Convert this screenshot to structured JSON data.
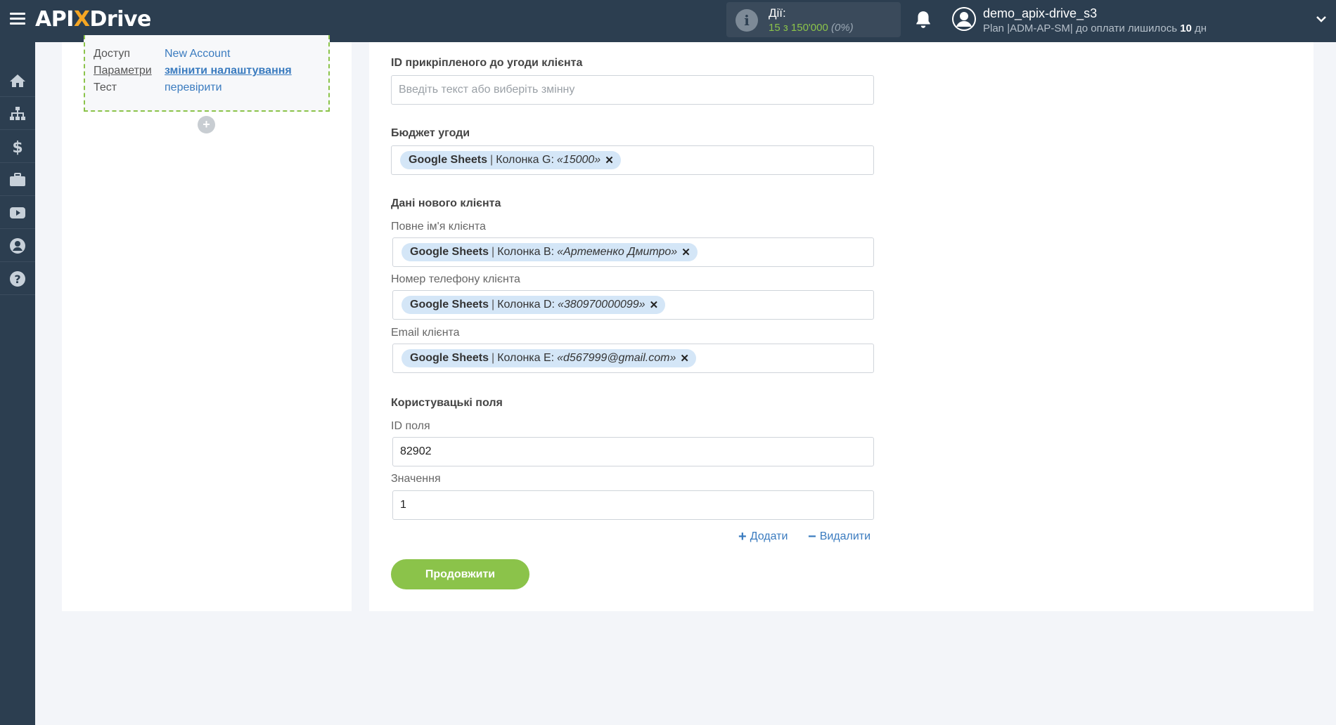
{
  "header": {
    "logo_api": "API",
    "logo_x": "X",
    "logo_drive": "Drive",
    "actions_label": "Дії:",
    "actions_count": "15 з 150'000",
    "actions_percent": "(0%)",
    "user_name": "demo_apix-drive_s3",
    "plan_text": "Plan |ADM-AP-SM| до оплати лишилось",
    "plan_days": "10",
    "plan_days_unit": "дн"
  },
  "sidebar": {
    "items": [
      {
        "icon": "home-icon"
      },
      {
        "icon": "sitemap-icon"
      },
      {
        "icon": "dollar-icon"
      },
      {
        "icon": "briefcase-icon"
      },
      {
        "icon": "youtube-icon"
      },
      {
        "icon": "user-icon"
      },
      {
        "icon": "help-icon"
      }
    ]
  },
  "left_panel": {
    "rows": [
      {
        "key": "Доступ",
        "value": "New Account"
      },
      {
        "key": "Параметри",
        "value": "змінити налаштування"
      },
      {
        "key": "Тест",
        "value": "перевірити"
      }
    ],
    "add_symbol": "+"
  },
  "form": {
    "client_deal_id": {
      "label": "ID прикріпленого до угоди клієнта",
      "placeholder": "Введіть текст або виберіть змінну",
      "value": ""
    },
    "deal_budget": {
      "label": "Бюджет угоди",
      "tag": {
        "source": "Google Sheets",
        "sep": "|",
        "column": "Колонка G:",
        "value": "«15000»"
      }
    },
    "new_client_section": "Дані нового клієнта",
    "client_full_name": {
      "label": "Повне ім'я клієнта",
      "tag": {
        "source": "Google Sheets",
        "sep": "|",
        "column": "Колонка B:",
        "value": "«Артеменко Дмитро»"
      }
    },
    "client_phone": {
      "label": "Номер телефону клієнта",
      "tag": {
        "source": "Google Sheets",
        "sep": "|",
        "column": "Колонка D:",
        "value": "«380970000099»"
      }
    },
    "client_email": {
      "label": "Email клієнта",
      "tag": {
        "source": "Google Sheets",
        "sep": "|",
        "column": "Колонка E:",
        "value": "«d567999@gmail.com»"
      }
    },
    "custom_fields_section": "Користувацькі поля",
    "field_id": {
      "label": "ID поля",
      "value": "82902"
    },
    "field_value": {
      "label": "Значення",
      "value": "1"
    },
    "add_label": "Додати",
    "remove_label": "Видалити",
    "continue_label": "Продовжити",
    "tag_close": "✕"
  },
  "colors": {
    "topbar": "#2c3e50",
    "accent_green": "#8bc34a",
    "link_blue": "#3a7bbf",
    "tag_bg": "#d4e6f7"
  }
}
